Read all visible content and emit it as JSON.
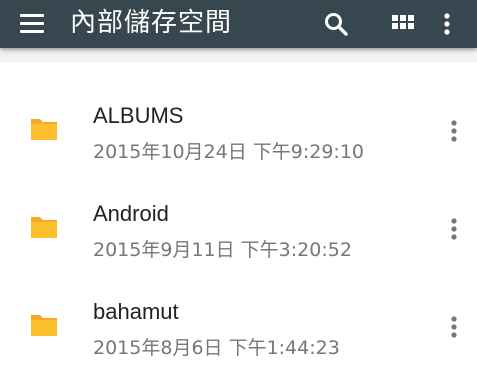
{
  "appbar": {
    "title": "內部儲存空間",
    "background": "#37474f",
    "icons": [
      "menu-icon",
      "search-icon",
      "grid-view-icon",
      "more-vert-icon"
    ]
  },
  "colors": {
    "folder": "#fbc02d",
    "folder_tab": "#f9a825",
    "name_text": "#222222",
    "date_text": "#777777"
  },
  "files": [
    {
      "name": "ALBUMS",
      "modified": "2015年10月24日 下午9:29:10",
      "type": "folder"
    },
    {
      "name": "Android",
      "modified": "2015年9月11日 下午3:20:52",
      "type": "folder"
    },
    {
      "name": "bahamut",
      "modified": "2015年8月6日 下午1:44:23",
      "type": "folder"
    }
  ]
}
